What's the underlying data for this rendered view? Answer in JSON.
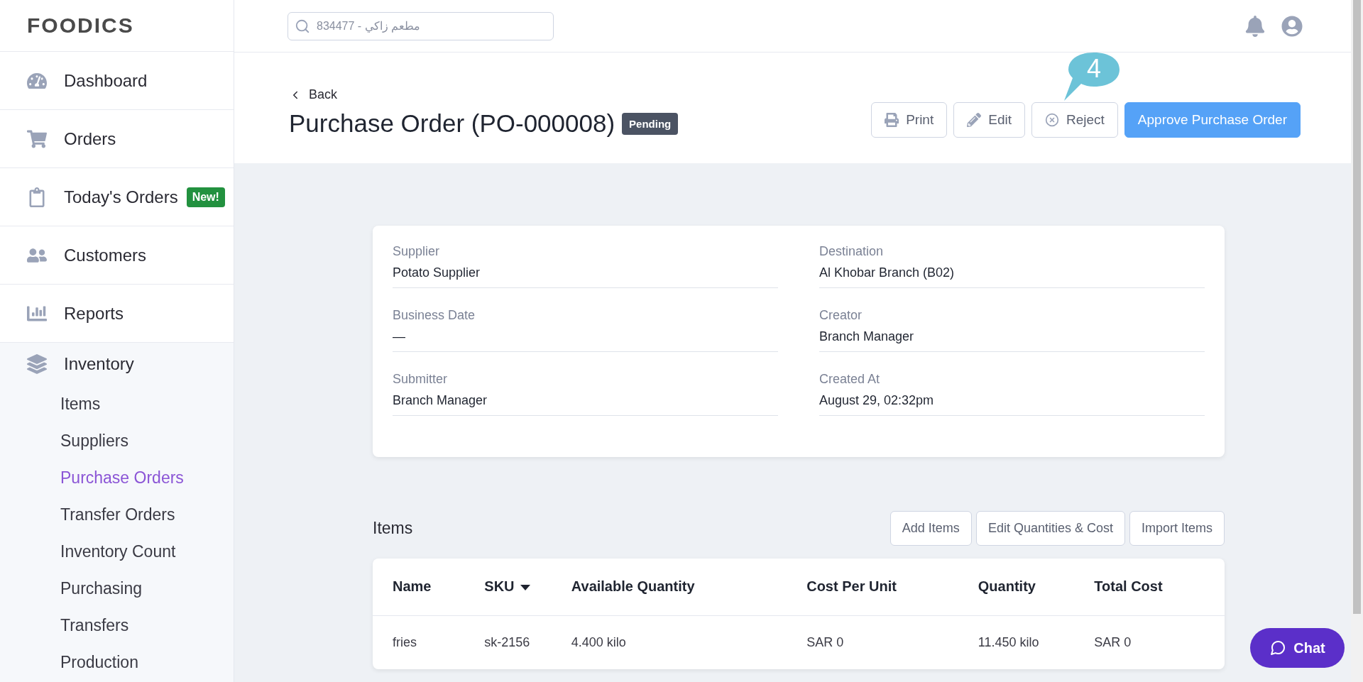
{
  "sidebar": {
    "logo": "FOODICS",
    "items": [
      {
        "label": "Dashboard",
        "selected": false
      },
      {
        "label": "Orders",
        "selected": false
      },
      {
        "label": "Today's Orders",
        "selected": false,
        "badge": "New!"
      },
      {
        "label": "Customers",
        "selected": false
      },
      {
        "label": "Reports",
        "selected": false
      },
      {
        "label": "Inventory",
        "selected": false,
        "children": [
          {
            "label": "Items",
            "selected": false
          },
          {
            "label": "Suppliers",
            "selected": false
          },
          {
            "label": "Purchase Orders",
            "selected": true
          },
          {
            "label": "Transfer Orders",
            "selected": false
          },
          {
            "label": "Inventory Count",
            "selected": false
          },
          {
            "label": "Purchasing",
            "selected": false
          },
          {
            "label": "Transfers",
            "selected": false
          },
          {
            "label": "Production",
            "selected": false
          }
        ]
      }
    ]
  },
  "topbar": {
    "search": {
      "placeholder": "834477 - مطعم زاكي"
    }
  },
  "page_header": {
    "back": "Back",
    "title": "Purchase Order (PO-000008)",
    "status": "Pending",
    "buttons": [
      {
        "label": "Print",
        "kind": "outline"
      },
      {
        "label": "Edit",
        "kind": "outline"
      },
      {
        "label": "Reject",
        "kind": "outline"
      },
      {
        "label": "Approve Purchase Order",
        "kind": "primary"
      }
    ],
    "callout": "4"
  },
  "details": [
    {
      "label": "Supplier",
      "value": "Potato Supplier"
    },
    {
      "label": "Destination",
      "value": "Al Khobar Branch (B02)"
    },
    {
      "label": "Business Date",
      "value": "—"
    },
    {
      "label": "Creator",
      "value": "Branch Manager"
    },
    {
      "label": "Submitter",
      "value": "Branch Manager"
    },
    {
      "label": "Created At",
      "value": "August 29, 02:32pm"
    }
  ],
  "items": {
    "title": "Items",
    "buttons": [
      "Add Items",
      "Edit Quantities & Cost",
      "Import Items"
    ],
    "columns": [
      {
        "label": "Name",
        "sorted": false
      },
      {
        "label": "SKU",
        "sorted": true
      },
      {
        "label": "Available Quantity",
        "sorted": false
      },
      {
        "label": "Cost Per Unit",
        "sorted": false
      },
      {
        "label": "Quantity",
        "sorted": false
      },
      {
        "label": "Total Cost",
        "sorted": false
      }
    ],
    "rows": [
      [
        "fries",
        "sk-2156",
        "4.400 kilo",
        "SAR 0",
        "11.450 kilo",
        "SAR 0"
      ]
    ]
  },
  "chat": "Chat"
}
